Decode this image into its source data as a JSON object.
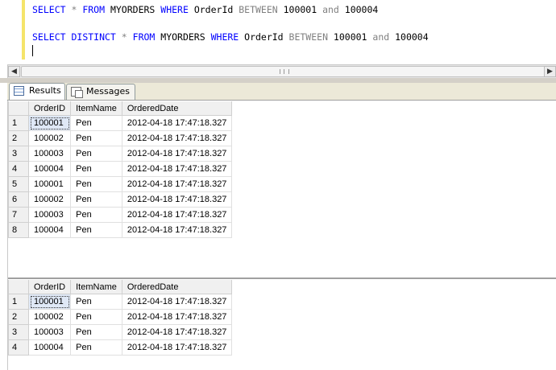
{
  "editor": {
    "line1": {
      "kw1": "SELECT",
      "star": " * ",
      "kw2": "FROM",
      "table": " MYORDERS ",
      "kw3": "WHERE",
      "col": " OrderId ",
      "kw4": "BETWEEN",
      "v1": " 100001 ",
      "kw5": "and",
      "v2": " 100004"
    },
    "line2": {
      "kw1": "SELECT",
      "kw1b": " DISTINCT",
      "star": " * ",
      "kw2": "FROM",
      "table": " MYORDERS ",
      "kw3": "WHERE",
      "col": " OrderId ",
      "kw4": "BETWEEN",
      "v1": " 100001 ",
      "kw5": "and",
      "v2": " 100004"
    }
  },
  "tabs": {
    "results": "Results",
    "messages": "Messages"
  },
  "columns": [
    "OrderID",
    "ItemName",
    "OrderedDate"
  ],
  "result1": [
    {
      "n": "1",
      "id": "100001",
      "item": "Pen",
      "date": "2012-04-18 17:47:18.327"
    },
    {
      "n": "2",
      "id": "100002",
      "item": "Pen",
      "date": "2012-04-18 17:47:18.327"
    },
    {
      "n": "3",
      "id": "100003",
      "item": "Pen",
      "date": "2012-04-18 17:47:18.327"
    },
    {
      "n": "4",
      "id": "100004",
      "item": "Pen",
      "date": "2012-04-18 17:47:18.327"
    },
    {
      "n": "5",
      "id": "100001",
      "item": "Pen",
      "date": "2012-04-18 17:47:18.327"
    },
    {
      "n": "6",
      "id": "100002",
      "item": "Pen",
      "date": "2012-04-18 17:47:18.327"
    },
    {
      "n": "7",
      "id": "100003",
      "item": "Pen",
      "date": "2012-04-18 17:47:18.327"
    },
    {
      "n": "8",
      "id": "100004",
      "item": "Pen",
      "date": "2012-04-18 17:47:18.327"
    }
  ],
  "result2": [
    {
      "n": "1",
      "id": "100001",
      "item": "Pen",
      "date": "2012-04-18 17:47:18.327"
    },
    {
      "n": "2",
      "id": "100002",
      "item": "Pen",
      "date": "2012-04-18 17:47:18.327"
    },
    {
      "n": "3",
      "id": "100003",
      "item": "Pen",
      "date": "2012-04-18 17:47:18.327"
    },
    {
      "n": "4",
      "id": "100004",
      "item": "Pen",
      "date": "2012-04-18 17:47:18.327"
    }
  ],
  "icons": {
    "results_tab": "grid-icon",
    "messages_tab": "messages-icon",
    "scroll_left": "arrow-left-icon",
    "scroll_right": "arrow-right-icon"
  },
  "colors": {
    "keyword": "#0000ff",
    "operator": "#808080",
    "selected_cell": "#dfe8f6"
  }
}
